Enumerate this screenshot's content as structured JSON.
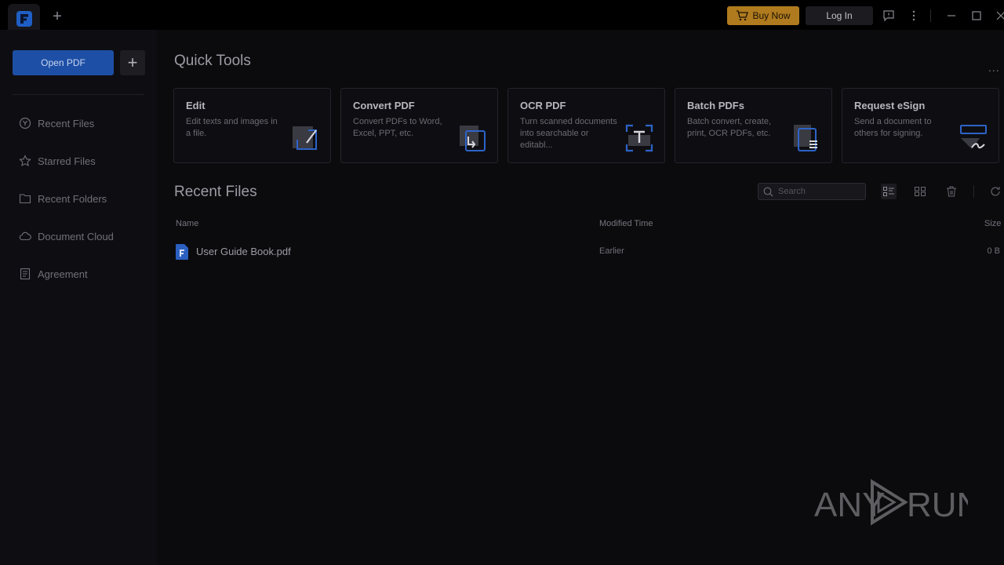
{
  "titlebar": {
    "buy_now": "Buy Now",
    "log_in": "Log In"
  },
  "sidebar": {
    "open_pdf": "Open PDF",
    "add": "+",
    "items": [
      {
        "label": "Recent Files",
        "icon": "clock-icon"
      },
      {
        "label": "Starred Files",
        "icon": "star-icon"
      },
      {
        "label": "Recent Folders",
        "icon": "folder-icon"
      },
      {
        "label": "Document Cloud",
        "icon": "cloud-icon"
      },
      {
        "label": "Agreement",
        "icon": "agreement-icon"
      }
    ]
  },
  "quick_tools": {
    "title": "Quick Tools",
    "more": "...",
    "tools": [
      {
        "title": "Edit",
        "desc": "Edit texts and images in a file."
      },
      {
        "title": "Convert PDF",
        "desc": "Convert PDFs to Word, Excel, PPT, etc."
      },
      {
        "title": "OCR PDF",
        "desc": "Turn scanned documents into searchable or editabl..."
      },
      {
        "title": "Batch PDFs",
        "desc": "Batch convert, create, print, OCR PDFs, etc."
      },
      {
        "title": "Request eSign",
        "desc": "Send a document to others for signing."
      }
    ]
  },
  "recent_files": {
    "title": "Recent Files",
    "search_placeholder": "Search",
    "columns": {
      "name": "Name",
      "modified": "Modified Time",
      "size": "Size"
    },
    "rows": [
      {
        "name": "User Guide Book.pdf",
        "modified": "Earlier",
        "size": "0 B"
      }
    ]
  },
  "watermark": {
    "left": "ANY",
    "right": "RUN"
  },
  "colors": {
    "accent": "#1d4fa6",
    "buy": "#b07b1e",
    "background": "#0b0b0e"
  }
}
